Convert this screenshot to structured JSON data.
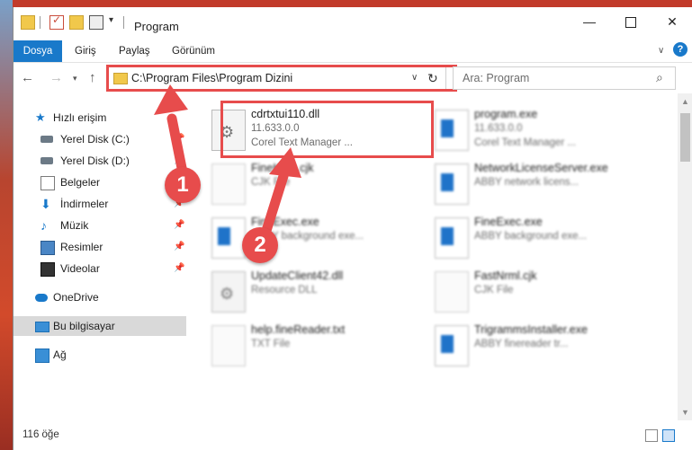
{
  "window": {
    "title": "Program",
    "minimize_glyph": "—",
    "close_glyph": "✕"
  },
  "ribbon": {
    "file_tab": "Dosya",
    "tabs": [
      "Giriş",
      "Paylaş",
      "Görünüm"
    ],
    "help_glyph": "?"
  },
  "nav": {
    "address": "C:\\Program Files\\Program Dizini",
    "search_placeholder": "Ara: Program"
  },
  "sidebar": {
    "items": [
      {
        "label": "Hızlı erişim",
        "icon": "star-icon"
      },
      {
        "label": "Yerel Disk (C:)",
        "icon": "drive-icon",
        "pinned": true
      },
      {
        "label": "Yerel Disk (D:)",
        "icon": "drive-icon",
        "pinned": true
      },
      {
        "label": "Belgeler",
        "icon": "documents-icon",
        "pinned": true
      },
      {
        "label": "İndirmeler",
        "icon": "download-icon",
        "pinned": true
      },
      {
        "label": "Müzik",
        "icon": "music-icon",
        "pinned": true
      },
      {
        "label": "Resimler",
        "icon": "pictures-icon",
        "pinned": true
      },
      {
        "label": "Videolar",
        "icon": "videos-icon",
        "pinned": true
      },
      {
        "label": "OneDrive",
        "icon": "onedrive-icon"
      },
      {
        "label": "Bu bilgisayar",
        "icon": "computer-icon",
        "selected": true
      },
      {
        "label": "Ağ",
        "icon": "network-icon"
      }
    ]
  },
  "files": [
    {
      "name": "cdrtxtui110.dll",
      "sub": "11.633.0.0",
      "desc": "Corel Text Manager ...",
      "type": "dll"
    },
    {
      "name": "program.exe",
      "sub": "11.633.0.0",
      "desc": "Corel Text Manager ...",
      "type": "exe"
    },
    {
      "name": "FineKorn.cjk",
      "sub": "CJK File",
      "desc": "",
      "type": "txt"
    },
    {
      "name": "NetworkLicenseServer.exe",
      "sub": "ABBY network licens...",
      "desc": "",
      "type": "exe"
    },
    {
      "name": "FineExec.exe",
      "sub": "ABBY background exe...",
      "desc": "",
      "type": "exe"
    },
    {
      "name": "FineExec.exe",
      "sub": "ABBY background exe...",
      "desc": "",
      "type": "exe"
    },
    {
      "name": "UpdateClient42.dll",
      "sub": "Resource DLL",
      "desc": "",
      "type": "dll"
    },
    {
      "name": "FastNrml.cjk",
      "sub": "CJK File",
      "desc": "",
      "type": "txt"
    },
    {
      "name": "help.fineReader.txt",
      "sub": "TXT File",
      "desc": "",
      "type": "txt"
    },
    {
      "name": "TrigrammsInstaller.exe",
      "sub": "ABBY finereader tr...",
      "desc": "",
      "type": "exe"
    }
  ],
  "status": {
    "count": "116 öğe"
  },
  "annotations": {
    "step1": "1",
    "step2": "2",
    "color": "#e74c4c"
  }
}
